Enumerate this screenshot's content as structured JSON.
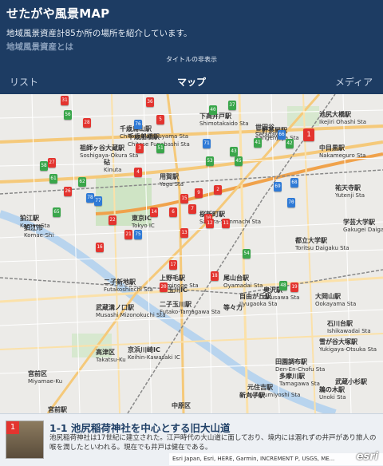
{
  "header": {
    "title": "せたがや風景MAP",
    "description": "地域風景資産計85か所の場所を紹介しています。",
    "link": "地域風景資産とは",
    "toggle_title": "タイトルの非表示"
  },
  "tabs": [
    {
      "label": "リスト",
      "active": false
    },
    {
      "label": "マップ",
      "active": true
    },
    {
      "label": "メディア",
      "active": false
    }
  ],
  "map": {
    "labels": [
      {
        "jp": "千歳烏山駅",
        "en": "Chitose-Karasuyama Sta"
      },
      {
        "jp": "祖師ヶ谷大蔵駅",
        "en": "Soshigaya-Okura Sta"
      },
      {
        "jp": "砧",
        "en": "Kinuta"
      },
      {
        "jp": "狛江駅",
        "en": "Komae Sta"
      },
      {
        "jp": "狛江市",
        "en": "Komae-Shi"
      },
      {
        "jp": "二子新地駅",
        "en": "Futakoshinchi Sta"
      },
      {
        "jp": "武蔵溝ノ口駅",
        "en": "Musashi Mizonokuchi Sta"
      },
      {
        "jp": "高津区",
        "en": "Takatsu-Ku"
      },
      {
        "jp": "宮前区",
        "en": "Miyamae-Ku"
      },
      {
        "jp": "上野毛駅",
        "en": "Kaminoge Sta"
      },
      {
        "jp": "尾山台駅",
        "en": "Oyamadai Sta"
      },
      {
        "jp": "等々力",
        "en": ""
      },
      {
        "jp": "自由が丘駅",
        "en": "Jiyugaoka Sta"
      },
      {
        "jp": "奥沢駅",
        "en": "Okusawa Sta"
      },
      {
        "jp": "大岡山駅",
        "en": "Ookayama Sta"
      },
      {
        "jp": "石川台駅",
        "en": "Ishikawadai Sta"
      },
      {
        "jp": "雪が谷大塚駅",
        "en": "Yukigaya-Otsuka Sta"
      },
      {
        "jp": "中目黒駅",
        "en": "Nakameguro Sta"
      },
      {
        "jp": "都立大学駅",
        "en": "Toritsu Daigaku Sta"
      },
      {
        "jp": "学芸大学駅",
        "en": "Gakugei Daigaku Sta"
      },
      {
        "jp": "祐天寺駅",
        "en": "Yutenji Sta"
      },
      {
        "jp": "池尻大橋駅",
        "en": "Ikejiri Ohashi Sta"
      },
      {
        "jp": "三軒茶屋駅",
        "en": "Sangenjaya Sta"
      },
      {
        "jp": "世田谷",
        "en": "Setagaya"
      },
      {
        "jp": "下高井戸駅",
        "en": "Shimotakaido Sta"
      },
      {
        "jp": "千歳船橋駅",
        "en": "Chitose Funabashi Sta"
      },
      {
        "jp": "用賀駅",
        "en": "Yoga Sta"
      },
      {
        "jp": "桜新町駅",
        "en": "Sakura-Shinmachi Sta"
      },
      {
        "jp": "二子玉川駅",
        "en": "Futako-Tamagawa Sta"
      },
      {
        "jp": "武蔵小杉駅",
        "en": ""
      },
      {
        "jp": "鵜の木駅",
        "en": "Unoki Sta"
      },
      {
        "jp": "田園調布駅",
        "en": "Den-En-Chofu Sta"
      },
      {
        "jp": "元住吉駅",
        "en": "Motosumiyoshi Sta"
      },
      {
        "jp": "新丸子駅",
        "en": ""
      },
      {
        "jp": "多摩川駅",
        "en": "Tamagawa Sta"
      },
      {
        "jp": "玉川IC",
        "en": ""
      },
      {
        "jp": "東京IC",
        "en": "Tokyo IC"
      },
      {
        "jp": "京浜川崎IC",
        "en": "Keihin-Kawasaki IC"
      },
      {
        "jp": "中原区",
        "en": ""
      },
      {
        "jp": "宮前駅",
        "en": ""
      }
    ],
    "markers": [
      {
        "num": "31",
        "color": "red"
      },
      {
        "num": "36",
        "color": "red"
      },
      {
        "num": "56",
        "color": "green"
      },
      {
        "num": "28",
        "color": "red"
      },
      {
        "num": "5",
        "color": "red"
      },
      {
        "num": "76",
        "color": "blue"
      },
      {
        "num": "3",
        "color": "red"
      },
      {
        "num": "1",
        "color": "red"
      },
      {
        "num": "51",
        "color": "green"
      },
      {
        "num": "4",
        "color": "red"
      },
      {
        "num": "58",
        "color": "green"
      },
      {
        "num": "27",
        "color": "red"
      },
      {
        "num": "61",
        "color": "green"
      },
      {
        "num": "62",
        "color": "green"
      },
      {
        "num": "26",
        "color": "red"
      },
      {
        "num": "78",
        "color": "blue"
      },
      {
        "num": "77",
        "color": "blue"
      },
      {
        "num": "15",
        "color": "red"
      },
      {
        "num": "7",
        "color": "red"
      },
      {
        "num": "6",
        "color": "red"
      },
      {
        "num": "69",
        "color": "blue"
      },
      {
        "num": "70",
        "color": "blue"
      },
      {
        "num": "9",
        "color": "red"
      },
      {
        "num": "2",
        "color": "red"
      },
      {
        "num": "10",
        "color": "red"
      },
      {
        "num": "12",
        "color": "red"
      },
      {
        "num": "11",
        "color": "red"
      },
      {
        "num": "13",
        "color": "red"
      },
      {
        "num": "14",
        "color": "red"
      },
      {
        "num": "22",
        "color": "red"
      },
      {
        "num": "21",
        "color": "red"
      },
      {
        "num": "75",
        "color": "blue"
      },
      {
        "num": "16",
        "color": "red"
      },
      {
        "num": "17",
        "color": "red"
      },
      {
        "num": "18",
        "color": "red"
      },
      {
        "num": "20",
        "color": "red"
      },
      {
        "num": "19",
        "color": "red"
      },
      {
        "num": "48",
        "color": "green"
      },
      {
        "num": "54",
        "color": "green"
      },
      {
        "num": "66",
        "color": "blue"
      },
      {
        "num": "71",
        "color": "blue"
      },
      {
        "num": "41",
        "color": "green"
      },
      {
        "num": "42",
        "color": "green"
      },
      {
        "num": "43",
        "color": "green"
      },
      {
        "num": "45",
        "color": "green"
      },
      {
        "num": "53",
        "color": "green"
      },
      {
        "num": "40",
        "color": "green"
      },
      {
        "num": "37",
        "color": "green"
      },
      {
        "num": "65",
        "color": "green"
      },
      {
        "num": "68",
        "color": "blue"
      }
    ],
    "selected_marker": "1"
  },
  "bottom": {
    "thumb_num": "1",
    "title": "1-1 池尻稲荷神社を中心とする旧大山道",
    "description": "池尻稲荷神社は17世紀に建立された。江戸時代の大山道に面しており、境内には涸れずの井戸があり旅人の喉を潤したといわれる。現在でも井戸は健在である。"
  },
  "attribution": "Esri Japan, Esri, HERE, Garmin, INCREMENT P, USGS, ME...",
  "esri_logo": "esri"
}
